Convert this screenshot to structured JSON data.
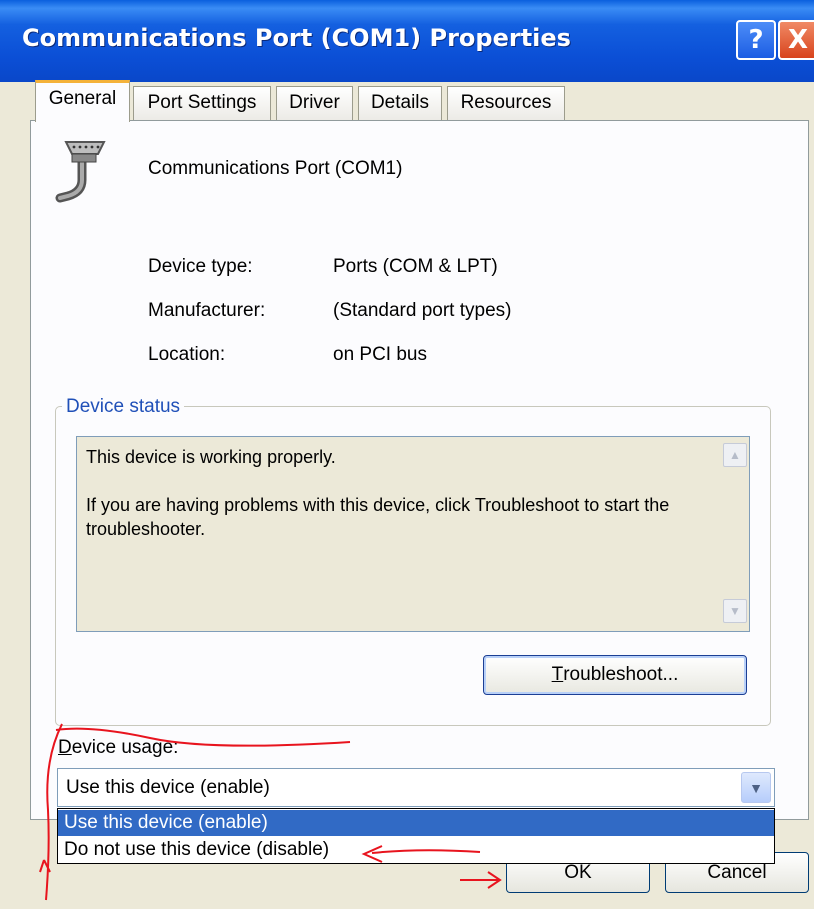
{
  "window": {
    "title": "Communications Port (COM1) Properties",
    "help_label": "?",
    "close_label": "X"
  },
  "tabs": [
    {
      "label": "General",
      "active": true
    },
    {
      "label": "Port Settings"
    },
    {
      "label": "Driver"
    },
    {
      "label": "Details"
    },
    {
      "label": "Resources"
    }
  ],
  "device": {
    "name": "Communications Port (COM1)",
    "icon": "serial-port-icon",
    "type_label": "Device type:",
    "type_value": "Ports (COM & LPT)",
    "manufacturer_label": "Manufacturer:",
    "manufacturer_value": "(Standard port types)",
    "location_label": "Location:",
    "location_value": "on PCI bus"
  },
  "status": {
    "group_label": "Device status",
    "line1": "This device is working properly.",
    "line2": "If you are having problems with this device, click Troubleshoot to start the troubleshooter.",
    "troubleshoot_pre": "",
    "troubleshoot_u": "T",
    "troubleshoot_post": "roubleshoot..."
  },
  "usage": {
    "label_u": "D",
    "label_rest": "evice usage:",
    "selected": "Use this device (enable)",
    "options": [
      "Use this device (enable)",
      "Do not use this device (disable)"
    ]
  },
  "footer": {
    "ok_label": "OK",
    "cancel_label": "Cancel"
  },
  "colors": {
    "annotation": "#e8141e",
    "selection": "#316ac5",
    "titlebar": "#0b4fd6"
  }
}
